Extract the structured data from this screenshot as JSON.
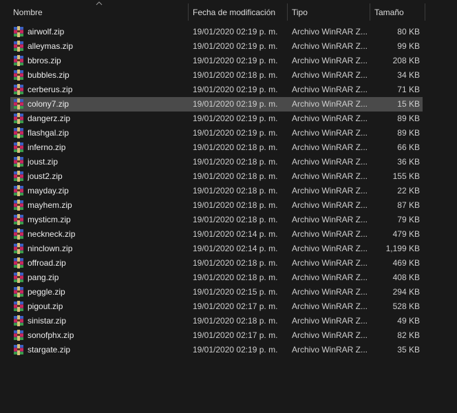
{
  "columns": {
    "name": "Nombre",
    "date": "Fecha de modificación",
    "type": "Tipo",
    "size": "Tamaño"
  },
  "files": [
    {
      "name": "airwolf.zip",
      "date": "19/01/2020 02:19 p. m.",
      "type": "Archivo WinRAR Z...",
      "size": "80 KB"
    },
    {
      "name": "alleymas.zip",
      "date": "19/01/2020 02:19 p. m.",
      "type": "Archivo WinRAR Z...",
      "size": "99 KB"
    },
    {
      "name": "bbros.zip",
      "date": "19/01/2020 02:19 p. m.",
      "type": "Archivo WinRAR Z...",
      "size": "208 KB"
    },
    {
      "name": "bubbles.zip",
      "date": "19/01/2020 02:18 p. m.",
      "type": "Archivo WinRAR Z...",
      "size": "34 KB"
    },
    {
      "name": "cerberus.zip",
      "date": "19/01/2020 02:19 p. m.",
      "type": "Archivo WinRAR Z...",
      "size": "71 KB"
    },
    {
      "name": "colony7.zip",
      "date": "19/01/2020 02:19 p. m.",
      "type": "Archivo WinRAR Z...",
      "size": "15 KB",
      "selected": true
    },
    {
      "name": "dangerz.zip",
      "date": "19/01/2020 02:19 p. m.",
      "type": "Archivo WinRAR Z...",
      "size": "89 KB"
    },
    {
      "name": "flashgal.zip",
      "date": "19/01/2020 02:19 p. m.",
      "type": "Archivo WinRAR Z...",
      "size": "89 KB"
    },
    {
      "name": "inferno.zip",
      "date": "19/01/2020 02:18 p. m.",
      "type": "Archivo WinRAR Z...",
      "size": "66 KB"
    },
    {
      "name": "joust.zip",
      "date": "19/01/2020 02:18 p. m.",
      "type": "Archivo WinRAR Z...",
      "size": "36 KB"
    },
    {
      "name": "joust2.zip",
      "date": "19/01/2020 02:18 p. m.",
      "type": "Archivo WinRAR Z...",
      "size": "155 KB"
    },
    {
      "name": "mayday.zip",
      "date": "19/01/2020 02:18 p. m.",
      "type": "Archivo WinRAR Z...",
      "size": "22 KB"
    },
    {
      "name": "mayhem.zip",
      "date": "19/01/2020 02:18 p. m.",
      "type": "Archivo WinRAR Z...",
      "size": "87 KB"
    },
    {
      "name": "mysticm.zip",
      "date": "19/01/2020 02:18 p. m.",
      "type": "Archivo WinRAR Z...",
      "size": "79 KB"
    },
    {
      "name": "neckneck.zip",
      "date": "19/01/2020 02:14 p. m.",
      "type": "Archivo WinRAR Z...",
      "size": "479 KB"
    },
    {
      "name": "ninclown.zip",
      "date": "19/01/2020 02:14 p. m.",
      "type": "Archivo WinRAR Z...",
      "size": "1,199 KB"
    },
    {
      "name": "offroad.zip",
      "date": "19/01/2020 02:18 p. m.",
      "type": "Archivo WinRAR Z...",
      "size": "469 KB"
    },
    {
      "name": "pang.zip",
      "date": "19/01/2020 02:18 p. m.",
      "type": "Archivo WinRAR Z...",
      "size": "408 KB"
    },
    {
      "name": "peggle.zip",
      "date": "19/01/2020 02:15 p. m.",
      "type": "Archivo WinRAR Z...",
      "size": "294 KB"
    },
    {
      "name": "pigout.zip",
      "date": "19/01/2020 02:17 p. m.",
      "type": "Archivo WinRAR Z...",
      "size": "528 KB"
    },
    {
      "name": "sinistar.zip",
      "date": "19/01/2020 02:18 p. m.",
      "type": "Archivo WinRAR Z...",
      "size": "49 KB"
    },
    {
      "name": "sonofphx.zip",
      "date": "19/01/2020 02:17 p. m.",
      "type": "Archivo WinRAR Z...",
      "size": "82 KB"
    },
    {
      "name": "stargate.zip",
      "date": "19/01/2020 02:19 p. m.",
      "type": "Archivo WinRAR Z...",
      "size": "35 KB"
    }
  ],
  "icons": {
    "file_icon": "winrar-archive-icon",
    "sort_icon": "sort-ascending-icon"
  },
  "colors": {
    "background": "#191919",
    "selected_row": "#4a4a4a",
    "text": "#e6e6e6"
  }
}
